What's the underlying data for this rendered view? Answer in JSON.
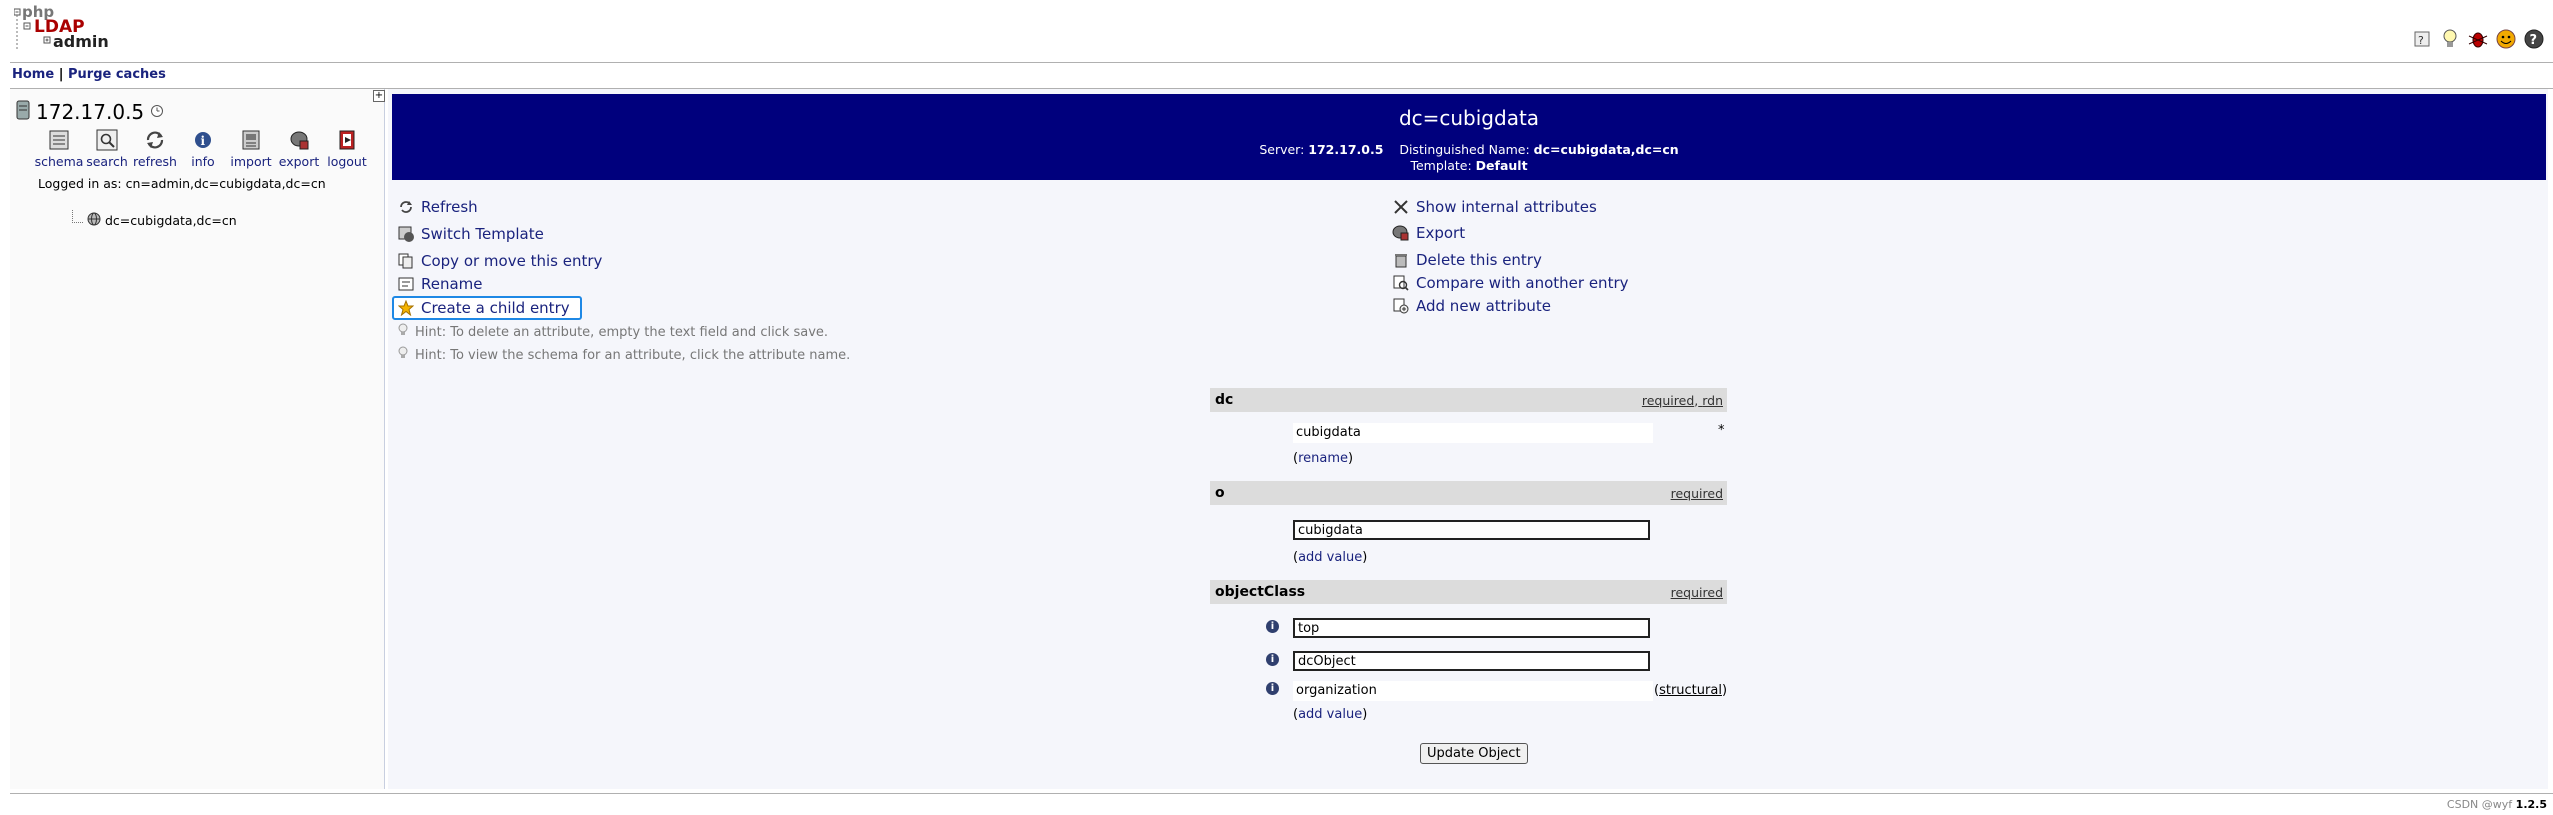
{
  "header": {
    "logo": {
      "word1": "php",
      "word2": "LDAP",
      "word3": "admin"
    },
    "top_icons": [
      "help-icon",
      "lightbulb-icon",
      "bug-icon",
      "smiley-icon",
      "question-icon"
    ]
  },
  "menu": {
    "home": "Home",
    "sep": "|",
    "purge": "Purge caches"
  },
  "left": {
    "server": "172.17.0.5",
    "toolbar": [
      {
        "label": "schema",
        "icon": "schema-icon"
      },
      {
        "label": "search",
        "icon": "search-icon"
      },
      {
        "label": "refresh",
        "icon": "refresh-icon"
      },
      {
        "label": "info",
        "icon": "info-icon"
      },
      {
        "label": "import",
        "icon": "import-icon"
      },
      {
        "label": "export",
        "icon": "export-icon"
      },
      {
        "label": "logout",
        "icon": "logout-icon"
      }
    ],
    "logged_in": "Logged in as: cn=admin,dc=cubigdata,dc=cn",
    "tree_item": "dc=cubigdata,dc=cn"
  },
  "banner": {
    "title": "dc=cubigdata",
    "server_label": "Server:",
    "server_value": "172.17.0.5",
    "dn_label": "Distinguished Name:",
    "dn_value": "dc=cubigdata,dc=cn",
    "template_label": "Template:",
    "template_value": "Default"
  },
  "actions_left": {
    "refresh": "Refresh",
    "switch_template": "Switch Template",
    "copy_move": "Copy or move this entry",
    "rename": "Rename",
    "create_child": "Create a child entry"
  },
  "actions_right": {
    "show_internal": "Show internal attributes",
    "export": "Export",
    "delete": "Delete this entry",
    "compare": "Compare with another entry",
    "add_attr": "Add new attribute"
  },
  "hints": [
    "Hint: To delete an attribute, empty the text field and click save.",
    "Hint: To view the schema for an attribute, click the attribute name."
  ],
  "attributes": {
    "dc": {
      "name": "dc",
      "req1": "required",
      "comma": ",",
      "req2": "rdn",
      "value": "cubigdata",
      "star": "*",
      "rename_open": "(",
      "rename": "rename",
      "rename_close": ")"
    },
    "o": {
      "name": "o",
      "req": "required",
      "value": "cubigdata",
      "add_open": "(",
      "add": "add value",
      "add_close": ")"
    },
    "objectClass": {
      "name": "objectClass",
      "req": "required",
      "v1": "top",
      "v2": "dcObject",
      "v3": "organization",
      "structural_open": "(",
      "structural": "structural",
      "structural_close": ")",
      "add_open": "(",
      "add": "add value",
      "add_close": ")"
    }
  },
  "update_button": "Update Object",
  "footer": {
    "watermark": "CSDN @wyf",
    "version": "1.2.5"
  }
}
